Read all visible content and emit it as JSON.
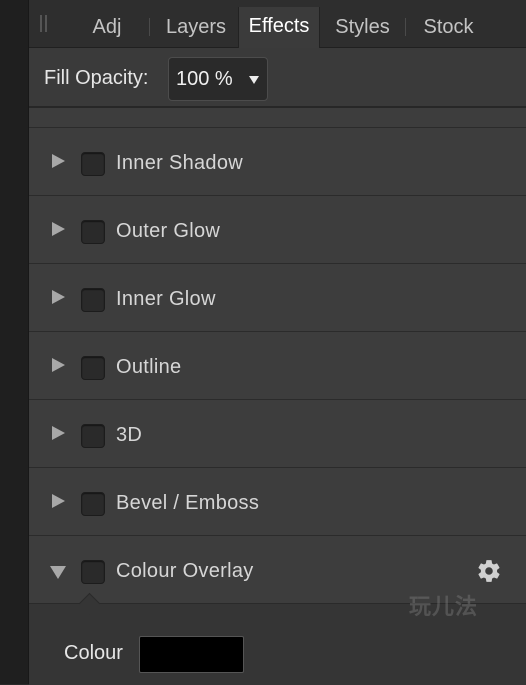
{
  "tabs": [
    {
      "label": "Adj",
      "active": false
    },
    {
      "label": "Layers",
      "active": false
    },
    {
      "label": "Effects",
      "active": true
    },
    {
      "label": "Styles",
      "active": false
    },
    {
      "label": "Stock",
      "active": false
    }
  ],
  "fill_opacity": {
    "label": "Fill Opacity:",
    "value": "100 %"
  },
  "effects": [
    {
      "name": "Inner Shadow",
      "expanded": false,
      "checked": false
    },
    {
      "name": "Outer Glow",
      "expanded": false,
      "checked": false
    },
    {
      "name": "Inner Glow",
      "expanded": false,
      "checked": false
    },
    {
      "name": "Outline",
      "expanded": false,
      "checked": false
    },
    {
      "name": "3D",
      "expanded": false,
      "checked": false
    },
    {
      "name": "Bevel / Emboss",
      "expanded": false,
      "checked": false
    },
    {
      "name": "Colour Overlay",
      "expanded": true,
      "checked": false
    }
  ],
  "colour_overlay": {
    "label": "Colour",
    "swatch_color": "#000000",
    "settings_icon": "gear-icon"
  },
  "watermark_text": "玩儿法",
  "colors": {
    "panel_bg": "#3b3b3b",
    "tab_bar_bg": "#2e2e2e",
    "active_tab_text": "#ffffff"
  }
}
